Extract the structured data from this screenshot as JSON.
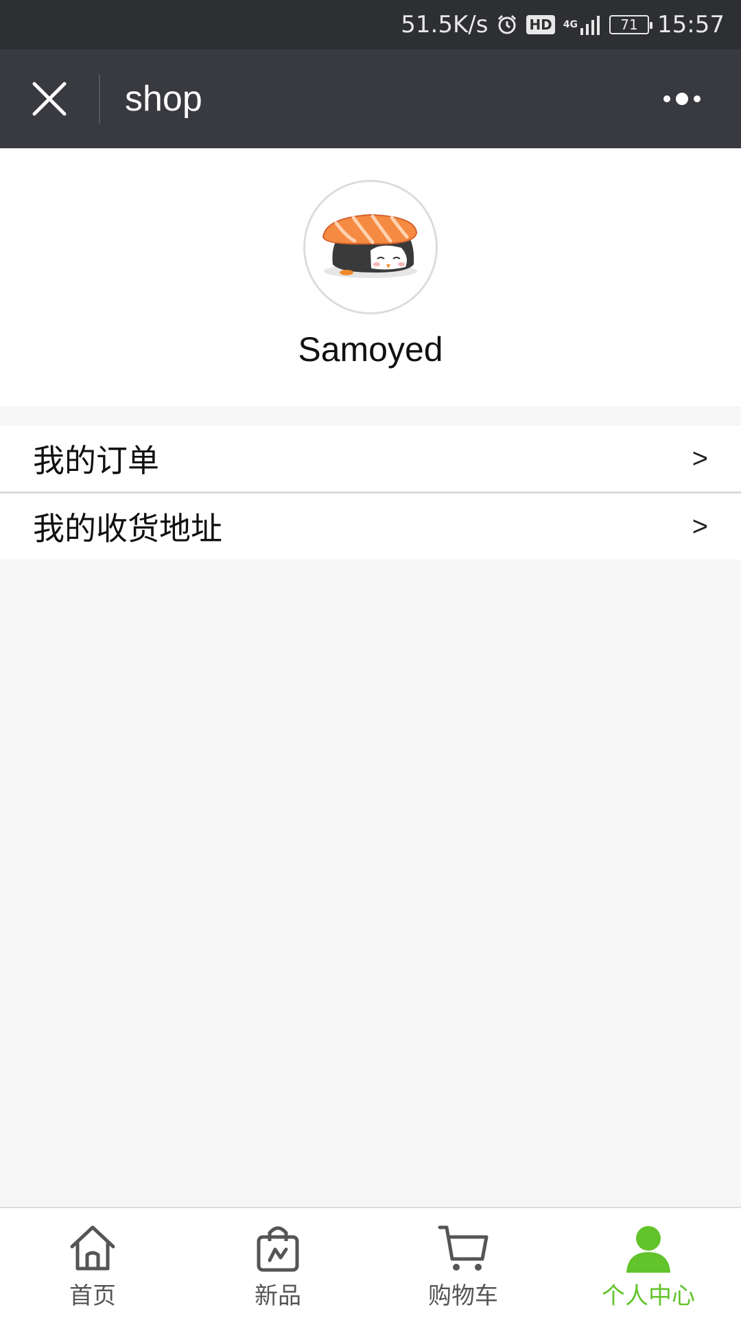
{
  "status_bar": {
    "network_speed": "51.5K/s",
    "hd_label": "HD",
    "network_type": "4G",
    "battery": "71",
    "time": "15:57"
  },
  "title_bar": {
    "title": "shop"
  },
  "profile": {
    "username": "Samoyed"
  },
  "menu": {
    "items": [
      {
        "label": "我的订单",
        "arrow": ">"
      },
      {
        "label": "我的收货地址",
        "arrow": ">"
      }
    ]
  },
  "tab_bar": {
    "active_color": "#62c32b",
    "tabs": [
      {
        "label": "首页",
        "icon": "home-icon"
      },
      {
        "label": "新品",
        "icon": "shopping-bag-icon"
      },
      {
        "label": "购物车",
        "icon": "cart-icon"
      },
      {
        "label": "个人中心",
        "icon": "person-icon",
        "active": true
      }
    ]
  }
}
